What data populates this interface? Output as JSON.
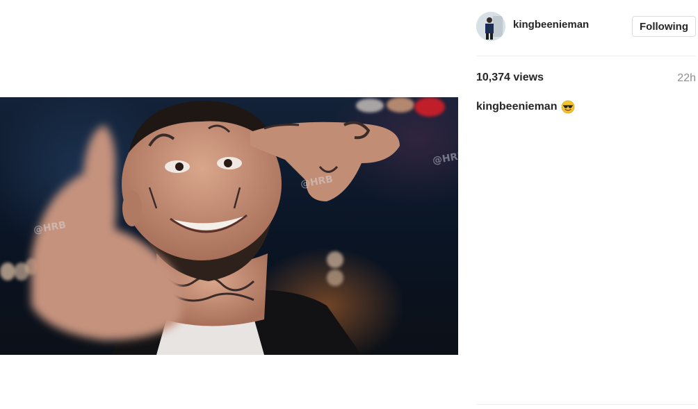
{
  "post": {
    "media": {
      "image_description": "",
      "watermark": "@HRB"
    },
    "header": {
      "username": "kingbeenieman",
      "follow_label": "Following"
    },
    "stats": {
      "views": "10,374 views",
      "time": "22h"
    },
    "caption": {
      "username": "kingbeenieman",
      "emoji": "smiling-face-with-sunglasses-icon"
    }
  }
}
